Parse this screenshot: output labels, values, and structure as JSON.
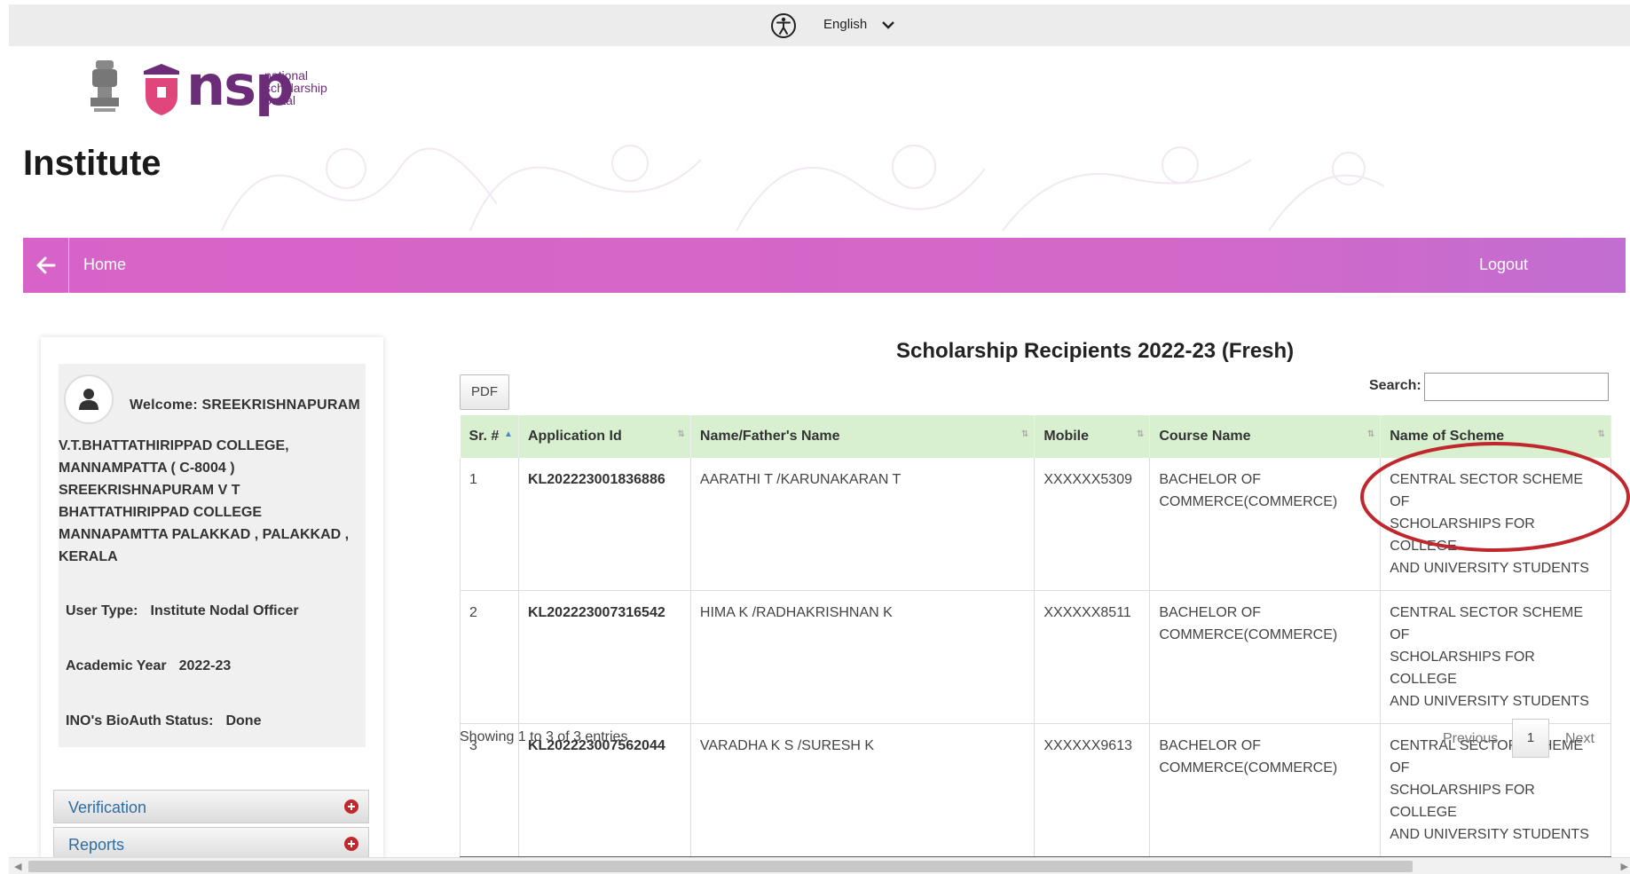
{
  "topbar": {
    "accessibility_icon": "accessibility-icon",
    "language": "English",
    "language_chevron_icon": "chevron-down-icon"
  },
  "brand": {
    "logo_text": "nsp",
    "logo_sub": [
      "national",
      "scholarship",
      "portal"
    ],
    "emblem_icon": "national-emblem-icon",
    "shield_icon": "nsp-shield-icon",
    "accent_color": "#6b2d78"
  },
  "page": {
    "section_title": "Institute"
  },
  "nav": {
    "back_icon": "arrow-left-icon",
    "home_label": "Home",
    "logout_label": "Logout",
    "bar_color": "#d863c8"
  },
  "sidebar": {
    "avatar_icon": "user-icon",
    "welcome": "Welcome: SREEKRISHNAPURAM",
    "college_lines": [
      "V.T.BHATTATHIRIPPAD COLLEGE,",
      "MANNAMPATTA ( C-8004 )",
      "SREEKRISHNAPURAM V T",
      "BHATTATHIRIPPAD COLLEGE",
      "MANNAPAMTTA PALAKKAD , PALAKKAD ,",
      "KERALA"
    ],
    "user_type_label": "User Type:",
    "user_type_value": "Institute Nodal Officer",
    "academic_year_label": "Academic Year",
    "academic_year_value": "2022-23",
    "bioauth_label": "INO's BioAuth Status:",
    "bioauth_value": "Done",
    "menu": [
      {
        "label": "Verification",
        "icon": "plus-circle-icon"
      },
      {
        "label": "Reports",
        "icon": "plus-circle-icon"
      }
    ]
  },
  "main": {
    "heading": "Scholarship Recipients 2022-23 (Fresh)",
    "pdf_label": "PDF",
    "search_label": "Search:",
    "search_value": "",
    "columns": [
      "Sr. #",
      "Application Id",
      "Name/Father's Name",
      "Mobile",
      "Course Name",
      "Name of Scheme"
    ],
    "rows": [
      {
        "sr": "1",
        "app_id": "KL202223001836886",
        "name": "AARATHI T /KARUNAKARAN T",
        "mobile": "XXXXXX5309",
        "course": [
          "BACHELOR OF",
          "COMMERCE(COMMERCE)"
        ],
        "scheme": [
          "CENTRAL SECTOR SCHEME OF",
          "SCHOLARSHIPS FOR COLLEGE",
          "AND UNIVERSITY STUDENTS"
        ]
      },
      {
        "sr": "2",
        "app_id": "KL202223007316542",
        "name": "HIMA K /RADHAKRISHNAN K",
        "mobile": "XXXXXX8511",
        "course": [
          "BACHELOR OF",
          "COMMERCE(COMMERCE)"
        ],
        "scheme": [
          "CENTRAL SECTOR SCHEME OF",
          "SCHOLARSHIPS FOR COLLEGE",
          "AND UNIVERSITY STUDENTS"
        ]
      },
      {
        "sr": "3",
        "app_id": "KL202223007562044",
        "name": "VARADHA K S /SURESH K",
        "mobile": "XXXXXX9613",
        "course": [
          "BACHELOR OF",
          "COMMERCE(COMMERCE)"
        ],
        "scheme": [
          "CENTRAL SECTOR SCHEME OF",
          "SCHOLARSHIPS FOR COLLEGE",
          "AND UNIVERSITY STUDENTS"
        ]
      }
    ],
    "info": "Showing 1 to 3 of 3 entries",
    "pager": {
      "prev": "Previous",
      "page": "1",
      "next": "Next"
    },
    "highlight_color": "#c0282d",
    "header_color": "#d8f0d0"
  }
}
